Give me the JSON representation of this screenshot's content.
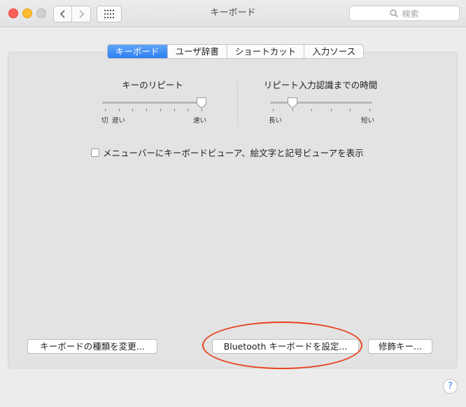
{
  "window": {
    "title": "キーボード"
  },
  "search": {
    "placeholder": "検索"
  },
  "tabs": [
    {
      "label": "キーボード",
      "active": true
    },
    {
      "label": "ユーザ辞書",
      "active": false
    },
    {
      "label": "ショートカット",
      "active": false
    },
    {
      "label": "入力ソース",
      "active": false
    }
  ],
  "key_repeat": {
    "title": "キーのリピート",
    "label_off": "切",
    "label_slow": "遅い",
    "label_fast": "速い",
    "tick_count": 8,
    "selected_index": 7
  },
  "repeat_delay": {
    "title": "リピート入力認識までの時間",
    "label_long": "長い",
    "label_short": "短い",
    "tick_count": 6,
    "selected_index": 1
  },
  "options": {
    "show_viewer_label": "メニューバーにキーボードビューア、絵文字と記号ビューアを表示",
    "show_viewer_checked": false
  },
  "buttons": {
    "change_type": "キーボードの種類を変更...",
    "bluetooth": "Bluetooth キーボードを設定...",
    "modifier": "修飾キー...",
    "help": "?"
  },
  "colors": {
    "accent": "#2d7ff2",
    "highlight_oval": "#e8431f"
  },
  "icons": {
    "back": "chevron-left-icon",
    "forward": "chevron-right-icon",
    "grid": "grid-icon",
    "search": "search-icon",
    "help": "help-icon"
  }
}
